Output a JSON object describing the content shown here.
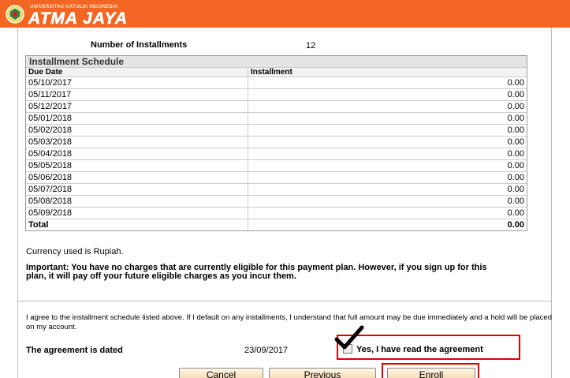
{
  "header": {
    "logo_small": "UNIVERSITAS KATOLIK INDONESIA",
    "logo_big": "ATMA JAYA",
    "logo_emblem": "university-emblem-icon",
    "color": "#f26522"
  },
  "summary": {
    "num_installments_label": "Number of Installments",
    "num_installments_value": "12"
  },
  "schedule": {
    "title": "Installment Schedule",
    "headers": [
      "Due Date",
      "Installment"
    ],
    "rows": [
      {
        "date": "05/10/2017",
        "amount": "0.00"
      },
      {
        "date": "05/11/2017",
        "amount": "0.00"
      },
      {
        "date": "05/12/2017",
        "amount": "0.00"
      },
      {
        "date": "05/01/2018",
        "amount": "0.00"
      },
      {
        "date": "05/02/2018",
        "amount": "0.00"
      },
      {
        "date": "05/03/2018",
        "amount": "0.00"
      },
      {
        "date": "05/04/2018",
        "amount": "0.00"
      },
      {
        "date": "05/05/2018",
        "amount": "0.00"
      },
      {
        "date": "05/06/2018",
        "amount": "0.00"
      },
      {
        "date": "05/07/2018",
        "amount": "0.00"
      },
      {
        "date": "05/08/2018",
        "amount": "0.00"
      },
      {
        "date": "05/09/2018",
        "amount": "0.00"
      }
    ],
    "total_label": "Total",
    "total_value": "0.00"
  },
  "notes": {
    "currency": "Currency used is Rupiah.",
    "important": "Important:  You have no charges that are currently eligible for this payment plan. However, if you sign up for this plan, it will pay off your future eligible charges as you incur them."
  },
  "agreement": {
    "text": "I agree to the installment schedule listed above.  If I default on any installments, I understand that full amount may be due immediately and a hold will be placed on my account.",
    "dated_label": "The agreement is dated",
    "dated_value": "23/09/2017",
    "checkbox_label": "Yes, I have read the agreement",
    "checked": true,
    "highlight_color": "#e00000"
  },
  "buttons": {
    "cancel": "Cancel",
    "previous": "Previous",
    "enroll": "Enroll"
  }
}
